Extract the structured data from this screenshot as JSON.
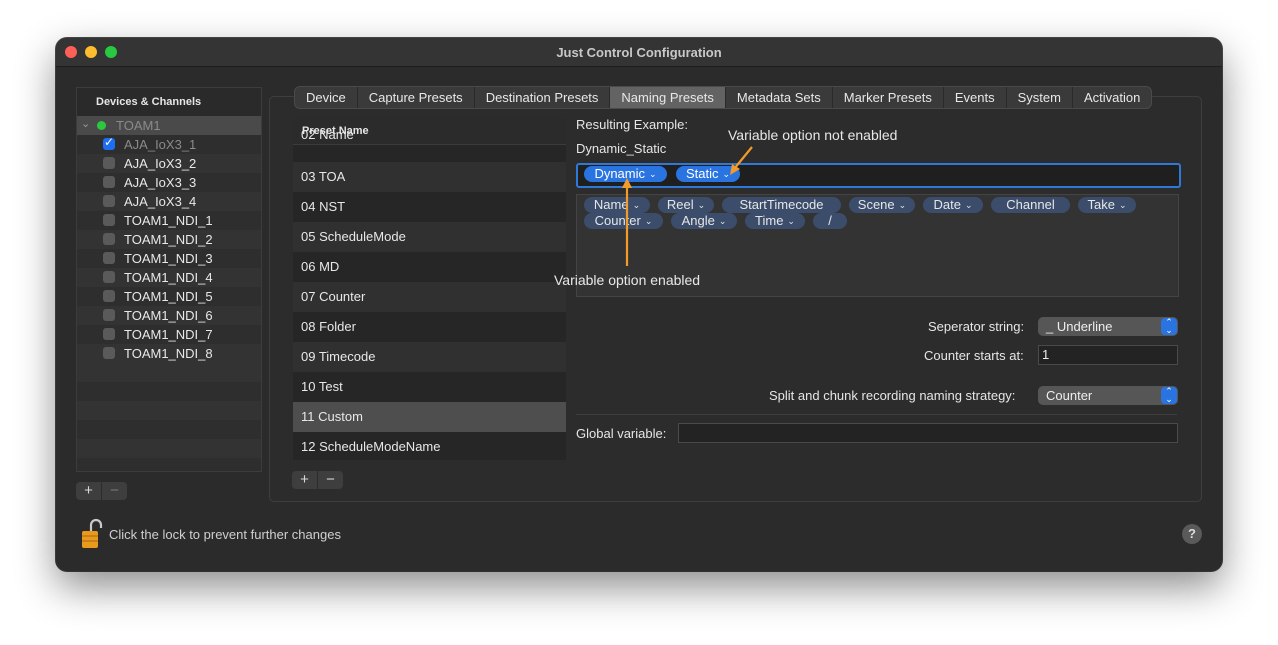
{
  "window": {
    "title": "Just Control Configuration"
  },
  "sidebar": {
    "header": "Devices & Channels",
    "root": {
      "label": "TOAM1"
    },
    "items": [
      {
        "label": "AJA_IoX3_1",
        "checked": true
      },
      {
        "label": "AJA_IoX3_2",
        "checked": false
      },
      {
        "label": "AJA_IoX3_3",
        "checked": false
      },
      {
        "label": "AJA_IoX3_4",
        "checked": false
      },
      {
        "label": "TOAM1_NDI_1",
        "checked": false
      },
      {
        "label": "TOAM1_NDI_2",
        "checked": false
      },
      {
        "label": "TOAM1_NDI_3",
        "checked": false
      },
      {
        "label": "TOAM1_NDI_4",
        "checked": false
      },
      {
        "label": "TOAM1_NDI_5",
        "checked": false
      },
      {
        "label": "TOAM1_NDI_6",
        "checked": false
      },
      {
        "label": "TOAM1_NDI_7",
        "checked": false
      },
      {
        "label": "TOAM1_NDI_8",
        "checked": false
      }
    ],
    "add_label": "+",
    "remove_label": "−"
  },
  "tabs": [
    {
      "label": "Device"
    },
    {
      "label": "Capture Presets"
    },
    {
      "label": "Destination Presets"
    },
    {
      "label": "Naming Presets",
      "active": true
    },
    {
      "label": "Metadata Sets"
    },
    {
      "label": "Marker Presets"
    },
    {
      "label": "Events"
    },
    {
      "label": "System"
    },
    {
      "label": "Activation"
    }
  ],
  "presets": {
    "header": "Preset Name",
    "items": [
      "02 Name",
      "03 TOA",
      "04 NST",
      "05 ScheduleMode",
      "06 MD",
      "07 Counter",
      "08 Folder",
      "09 Timecode",
      "10 Test",
      "11 Custom",
      "12 ScheduleModeName"
    ],
    "selected": "11 Custom",
    "add_label": "+",
    "remove_label": "−"
  },
  "naming": {
    "resulting_label": "Resulting Example:",
    "resulting_value": "Dynamic_Static",
    "tokens": [
      "Dynamic",
      "Static"
    ],
    "palette_row1": [
      "Name",
      "Reel",
      "StartTimecode",
      "Scene",
      "Date",
      "Channel",
      "Take"
    ],
    "palette_row2": [
      "Counter",
      "Angle",
      "Time",
      "/"
    ],
    "separator_label": "Seperator string:",
    "separator_value": "_ Underline",
    "counter_label": "Counter starts at:",
    "counter_value": "1",
    "split_label": "Split and chunk recording naming strategy:",
    "split_value": "Counter",
    "global_label": "Global variable:",
    "global_value": ""
  },
  "annotations": {
    "not_enabled": "Variable option not enabled",
    "enabled": "Variable option enabled",
    "arrow_color": "#f39a2b"
  },
  "footer": {
    "lock_text": "Click the lock to prevent further changes",
    "help_label": "?"
  },
  "colors": {
    "accent": "#2a74e2",
    "window_bg": "#2b2b2b"
  }
}
